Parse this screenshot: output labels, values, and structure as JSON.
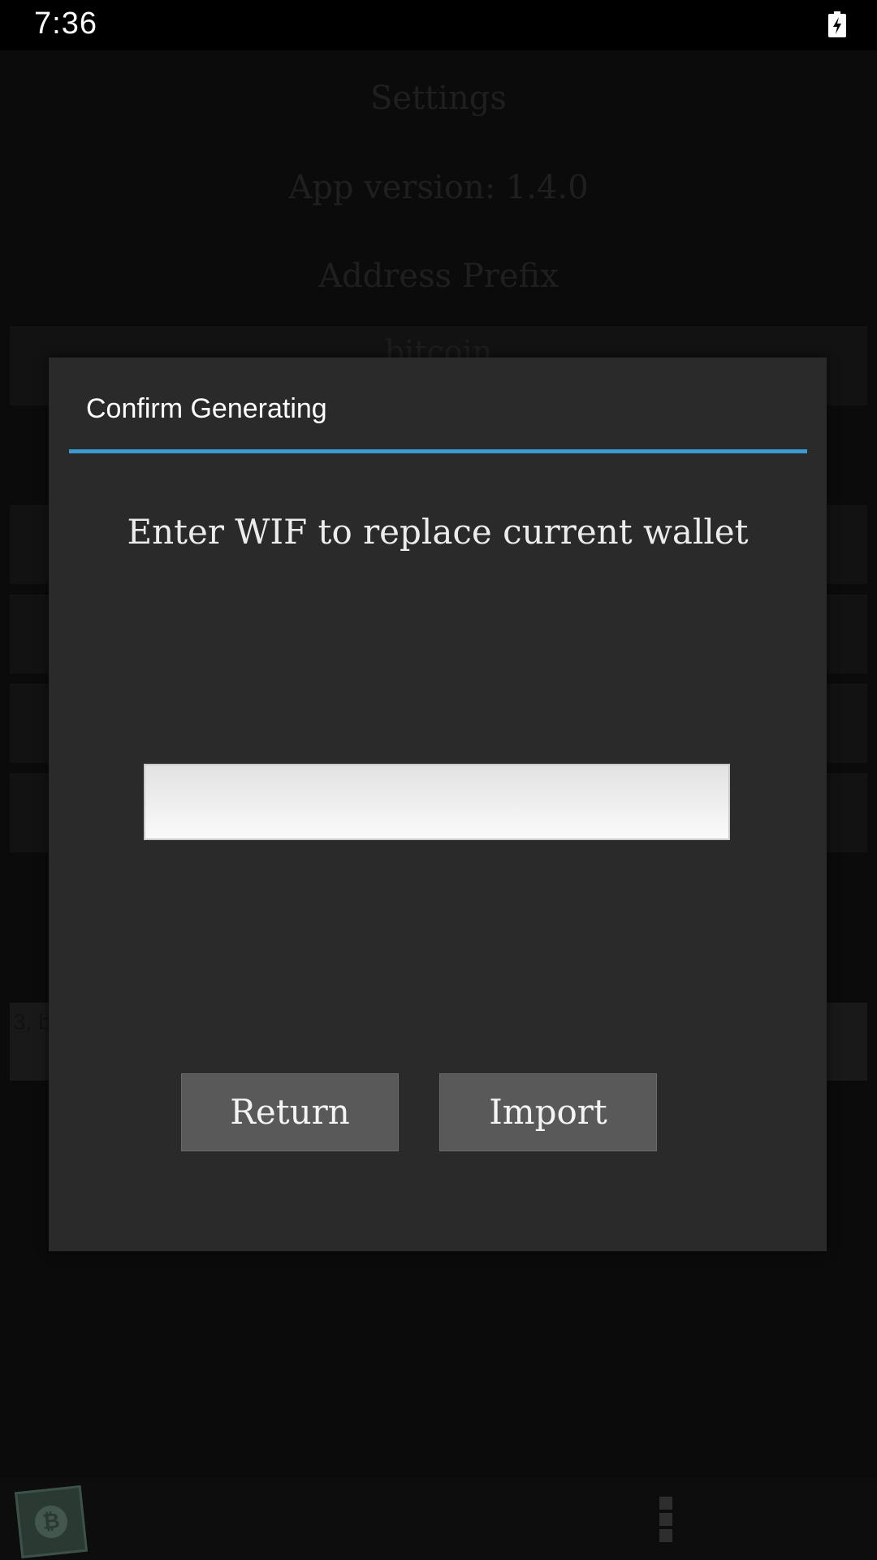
{
  "status_bar": {
    "time": "7:36",
    "battery_icon": "battery-charging-icon"
  },
  "background": {
    "title": "Settings",
    "app_version": "App version: 1.4.0",
    "address_prefix_label": "Address Prefix",
    "address_prefix_value": "bitcoin",
    "field_partial_text": "3, b"
  },
  "dialog": {
    "title": "Confirm Generating",
    "message": "Enter WIF to replace current wallet",
    "wif_input": {
      "value": "",
      "placeholder": ""
    },
    "return_label": "Return",
    "import_label": "Import",
    "accent_color": "#3b9bd0"
  },
  "bottom_bar": {
    "app_icon": "bitcoin-wallet-icon",
    "menu_icon": "overflow-menu-icon"
  }
}
